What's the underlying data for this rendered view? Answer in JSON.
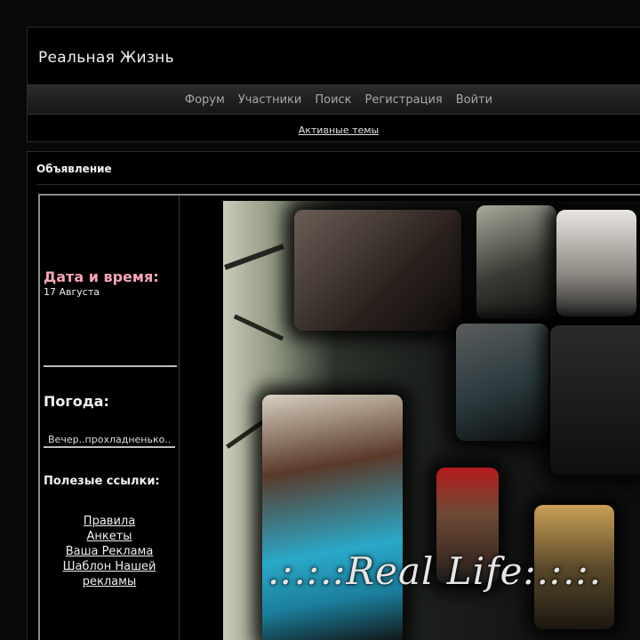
{
  "site": {
    "title": "Реальная Жизнь"
  },
  "nav": {
    "items": [
      "Форум",
      "Участники",
      "Поиск",
      "Регистрация",
      "Войти"
    ],
    "active_topics": "Активные темы"
  },
  "announcement": {
    "title": "Объявление",
    "datetime_title": "Дата и время:",
    "datetime_value": "17 Августа",
    "weather_title": "Погода:",
    "weather_value": "Вечер..прохладненько..",
    "links_title": "Полезые ссылки:",
    "links": [
      "Правила",
      "Анкеты",
      "Ваша Реклама",
      "Шаблон Нашей рекламы"
    ],
    "collage_text": ".:.:.:Real Life:.:.:."
  }
}
